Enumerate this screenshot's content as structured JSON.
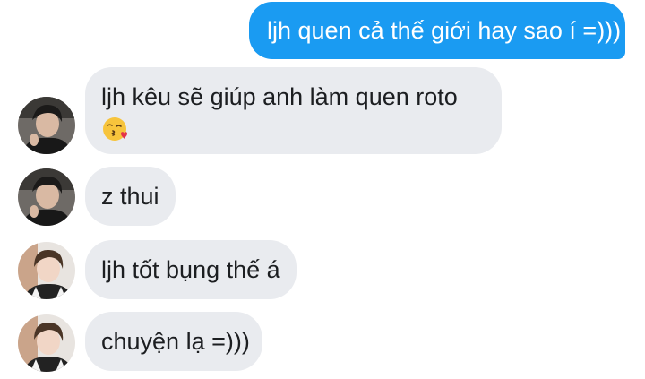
{
  "messages": [
    {
      "sender": "me",
      "text": "ljh quen cả thế giới hay sao í =)))"
    },
    {
      "sender": "other",
      "avatar": "avatar-a",
      "text": "ljh kêu sẽ giúp anh làm quen roto",
      "emoji": "face-blowing-kiss-emoji"
    },
    {
      "sender": "other",
      "avatar": "avatar-a",
      "text": "z thui"
    },
    {
      "sender": "other",
      "avatar": "avatar-b",
      "text": "ljh tốt bụng thế á"
    },
    {
      "sender": "other",
      "avatar": "avatar-b",
      "text": "chuyện lạ =)))"
    }
  ],
  "colors": {
    "sent_bubble": "#1a9bf2",
    "received_bubble": "#e9ebef",
    "received_text": "#1c1e21"
  }
}
